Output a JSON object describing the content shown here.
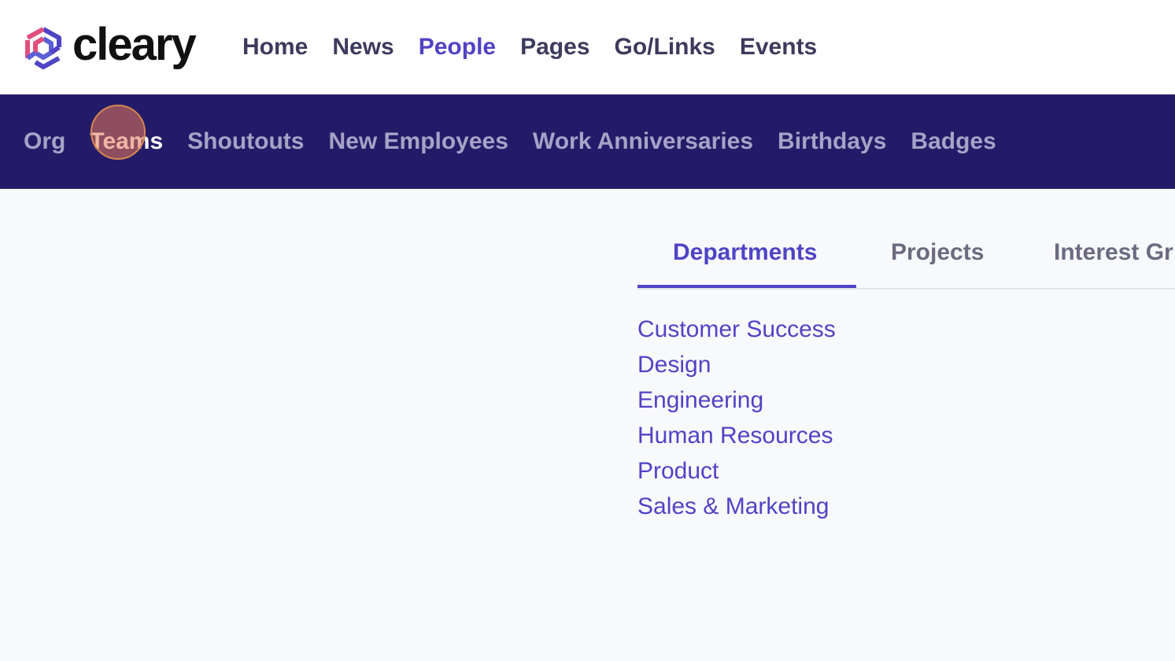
{
  "brand": {
    "name": "cleary",
    "colors": {
      "primary": "#4f43c6",
      "navy": "#241b68",
      "pink": "#e24f7c"
    }
  },
  "main_nav": {
    "items": [
      {
        "label": "Home",
        "active": false
      },
      {
        "label": "News",
        "active": false
      },
      {
        "label": "People",
        "active": true
      },
      {
        "label": "Pages",
        "active": false
      },
      {
        "label": "Go/Links",
        "active": false
      },
      {
        "label": "Events",
        "active": false
      }
    ]
  },
  "sub_nav": {
    "items": [
      {
        "label": "Org",
        "active": false
      },
      {
        "label": "Teams",
        "active": true
      },
      {
        "label": "Shoutouts",
        "active": false
      },
      {
        "label": "New Employees",
        "active": false
      },
      {
        "label": "Work Anniversaries",
        "active": false
      },
      {
        "label": "Birthdays",
        "active": false
      },
      {
        "label": "Badges",
        "active": false
      }
    ]
  },
  "teams": {
    "tabs": [
      {
        "label": "Departments",
        "active": true
      },
      {
        "label": "Projects",
        "active": false
      },
      {
        "label": "Interest Gr",
        "active": false
      }
    ],
    "departments": [
      "Customer Success",
      "Design",
      "Engineering",
      "Human Resources",
      "Product",
      "Sales & Marketing"
    ]
  }
}
